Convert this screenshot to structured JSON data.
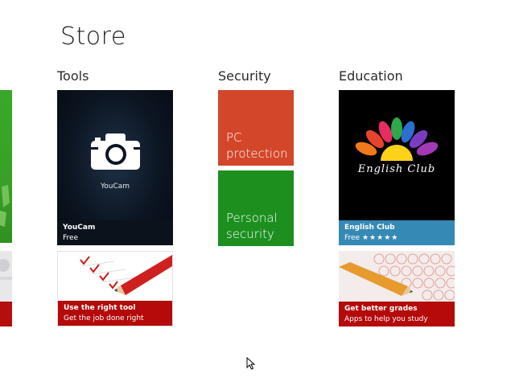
{
  "page": {
    "title": "Store"
  },
  "groups": {
    "tools": "Tools",
    "security": "Security",
    "education": "Education"
  },
  "tiles": {
    "youcam": {
      "logo_label": "YouCam",
      "title": "YouCam",
      "subtitle": "Free"
    },
    "right_tool": {
      "title": "Use the right tool",
      "subtitle": "Get the job done right"
    },
    "pc_protection": {
      "label_line1": "PC",
      "label_line2": "protection"
    },
    "personal_security": {
      "label_line1": "Personal",
      "label_line2": "security"
    },
    "english_club": {
      "logo_text": "English Club",
      "title": "English Club",
      "subtitle": "Free",
      "stars": "★★★★★",
      "rating": 5
    },
    "better_grades": {
      "title": "Get better grades",
      "subtitle": "Apps to help you study"
    }
  },
  "colors": {
    "security_pc": "#d4462a",
    "security_personal": "#1c8f1f",
    "english_caption": "#3589b5",
    "red_caption": "#b40a0a"
  }
}
